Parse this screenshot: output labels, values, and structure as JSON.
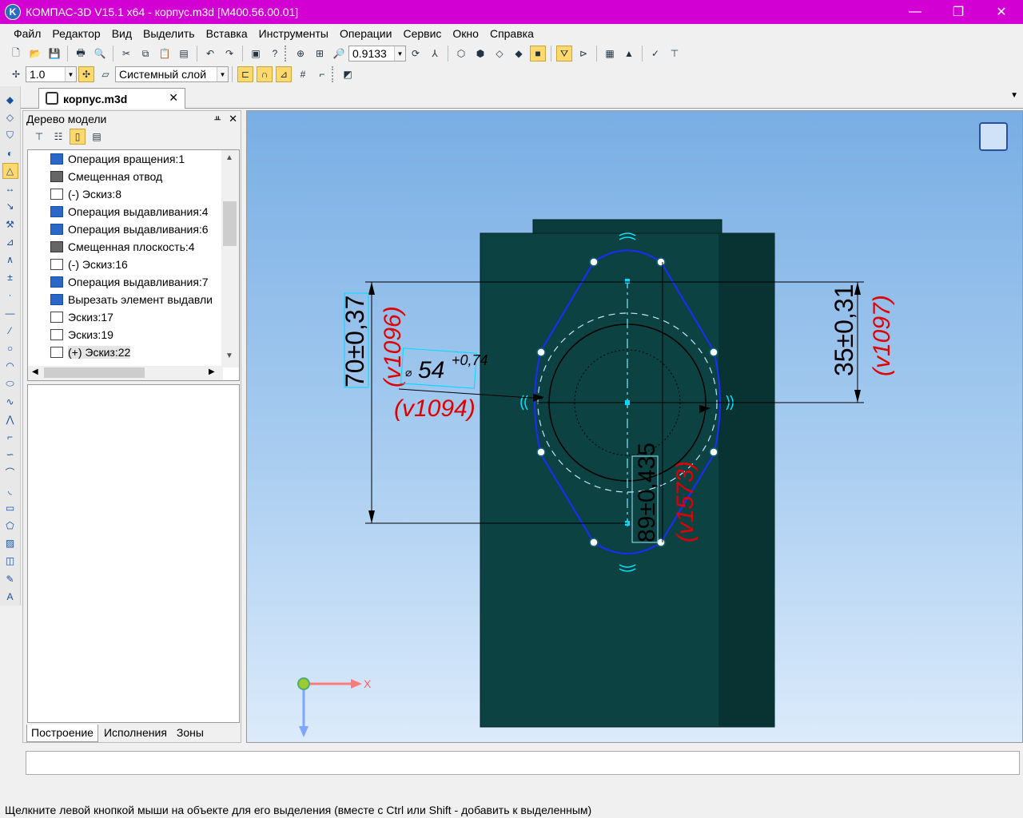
{
  "window": {
    "title": "КОМПАС-3D V15.1 x64 - корпус.m3d [М400.56.00.01]",
    "minimize": "—",
    "maximize": "❐",
    "close": "✕"
  },
  "menu": [
    "Файл",
    "Редактор",
    "Вид",
    "Выделить",
    "Вставка",
    "Инструменты",
    "Операции",
    "Сервис",
    "Окно",
    "Справка"
  ],
  "toolbar": {
    "zoom_value": "0.9133",
    "step_value": "1.0",
    "layer_value": "Системный слой"
  },
  "document_tab": {
    "label": "корпус.m3d",
    "close": "✕"
  },
  "panel": {
    "title": "Дерево модели",
    "pin": "ᚇ",
    "close": "✕",
    "tree_items": [
      {
        "label": "Операция вращения:1",
        "kind": "op"
      },
      {
        "label": "Смещенная отвод",
        "kind": "plane"
      },
      {
        "label": "(-) Эскиз:8",
        "kind": "sketch"
      },
      {
        "label": "Операция выдавливания:4",
        "kind": "op"
      },
      {
        "label": "Операция выдавливания:6",
        "kind": "op"
      },
      {
        "label": "Смещенная плоскость:4",
        "kind": "plane"
      },
      {
        "label": "(-) Эскиз:16",
        "kind": "sketch"
      },
      {
        "label": "Операция выдавливания:7",
        "kind": "op"
      },
      {
        "label": "Вырезать элемент выдавли",
        "kind": "op"
      },
      {
        "label": "Эскиз:17",
        "kind": "sketch"
      },
      {
        "label": "Эскиз:19",
        "kind": "sketch"
      },
      {
        "label": "(+) Эскиз:22",
        "kind": "sketch-active"
      }
    ],
    "tabs": [
      "Построение",
      "Исполнения",
      "Зоны"
    ]
  },
  "viewport": {
    "dimensions": {
      "d1": "70±0,37",
      "d1_var": "(v1096)",
      "d2": "35±0,31",
      "d2_var": "(v1097)",
      "d3": "54",
      "d3_tol": "+0,74",
      "d3_var": "(v1094)",
      "d4": "89±0,435",
      "d4_var": "(v1573)"
    },
    "axis_x": "X"
  },
  "status": {
    "message": "Щелкните левой кнопкой мыши на объекте для его выделения (вместе с Ctrl или Shift - добавить к выделенным)"
  }
}
